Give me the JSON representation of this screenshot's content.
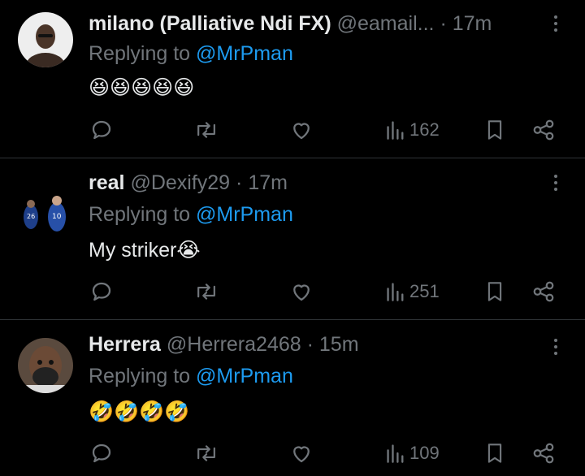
{
  "tweets": [
    {
      "name": "milano (Palliative Ndi FX)",
      "handle": "@eamail...",
      "dot": "·",
      "time": "17m",
      "reply_prefix": "Replying to",
      "reply_to": "@MrPman",
      "text": "😆😆😆😆😆",
      "views": "162",
      "avatar": "person-avatar"
    },
    {
      "name": "real",
      "handle": "@Dexify29",
      "dot": "·",
      "time": "17m",
      "reply_prefix": "Replying to",
      "reply_to": "@MrPman",
      "text": "My striker😭",
      "views": "251",
      "avatar": "footballers-avatar"
    },
    {
      "name": "Herrera",
      "handle": "@Herrera2468",
      "dot": "·",
      "time": "15m",
      "reply_prefix": "Replying to",
      "reply_to": "@MrPman",
      "text": "🤣🤣🤣🤣",
      "views": "109",
      "avatar": "bearded-avatar"
    }
  ],
  "colors": {
    "background": "#000000",
    "primary_text": "#e7e9ea",
    "secondary_text": "#71767b",
    "link": "#1d9bf0",
    "divider": "#2f3336"
  },
  "icons": [
    "reply-icon",
    "retweet-icon",
    "like-icon",
    "views-icon",
    "bookmark-icon",
    "share-icon",
    "more-icon"
  ]
}
